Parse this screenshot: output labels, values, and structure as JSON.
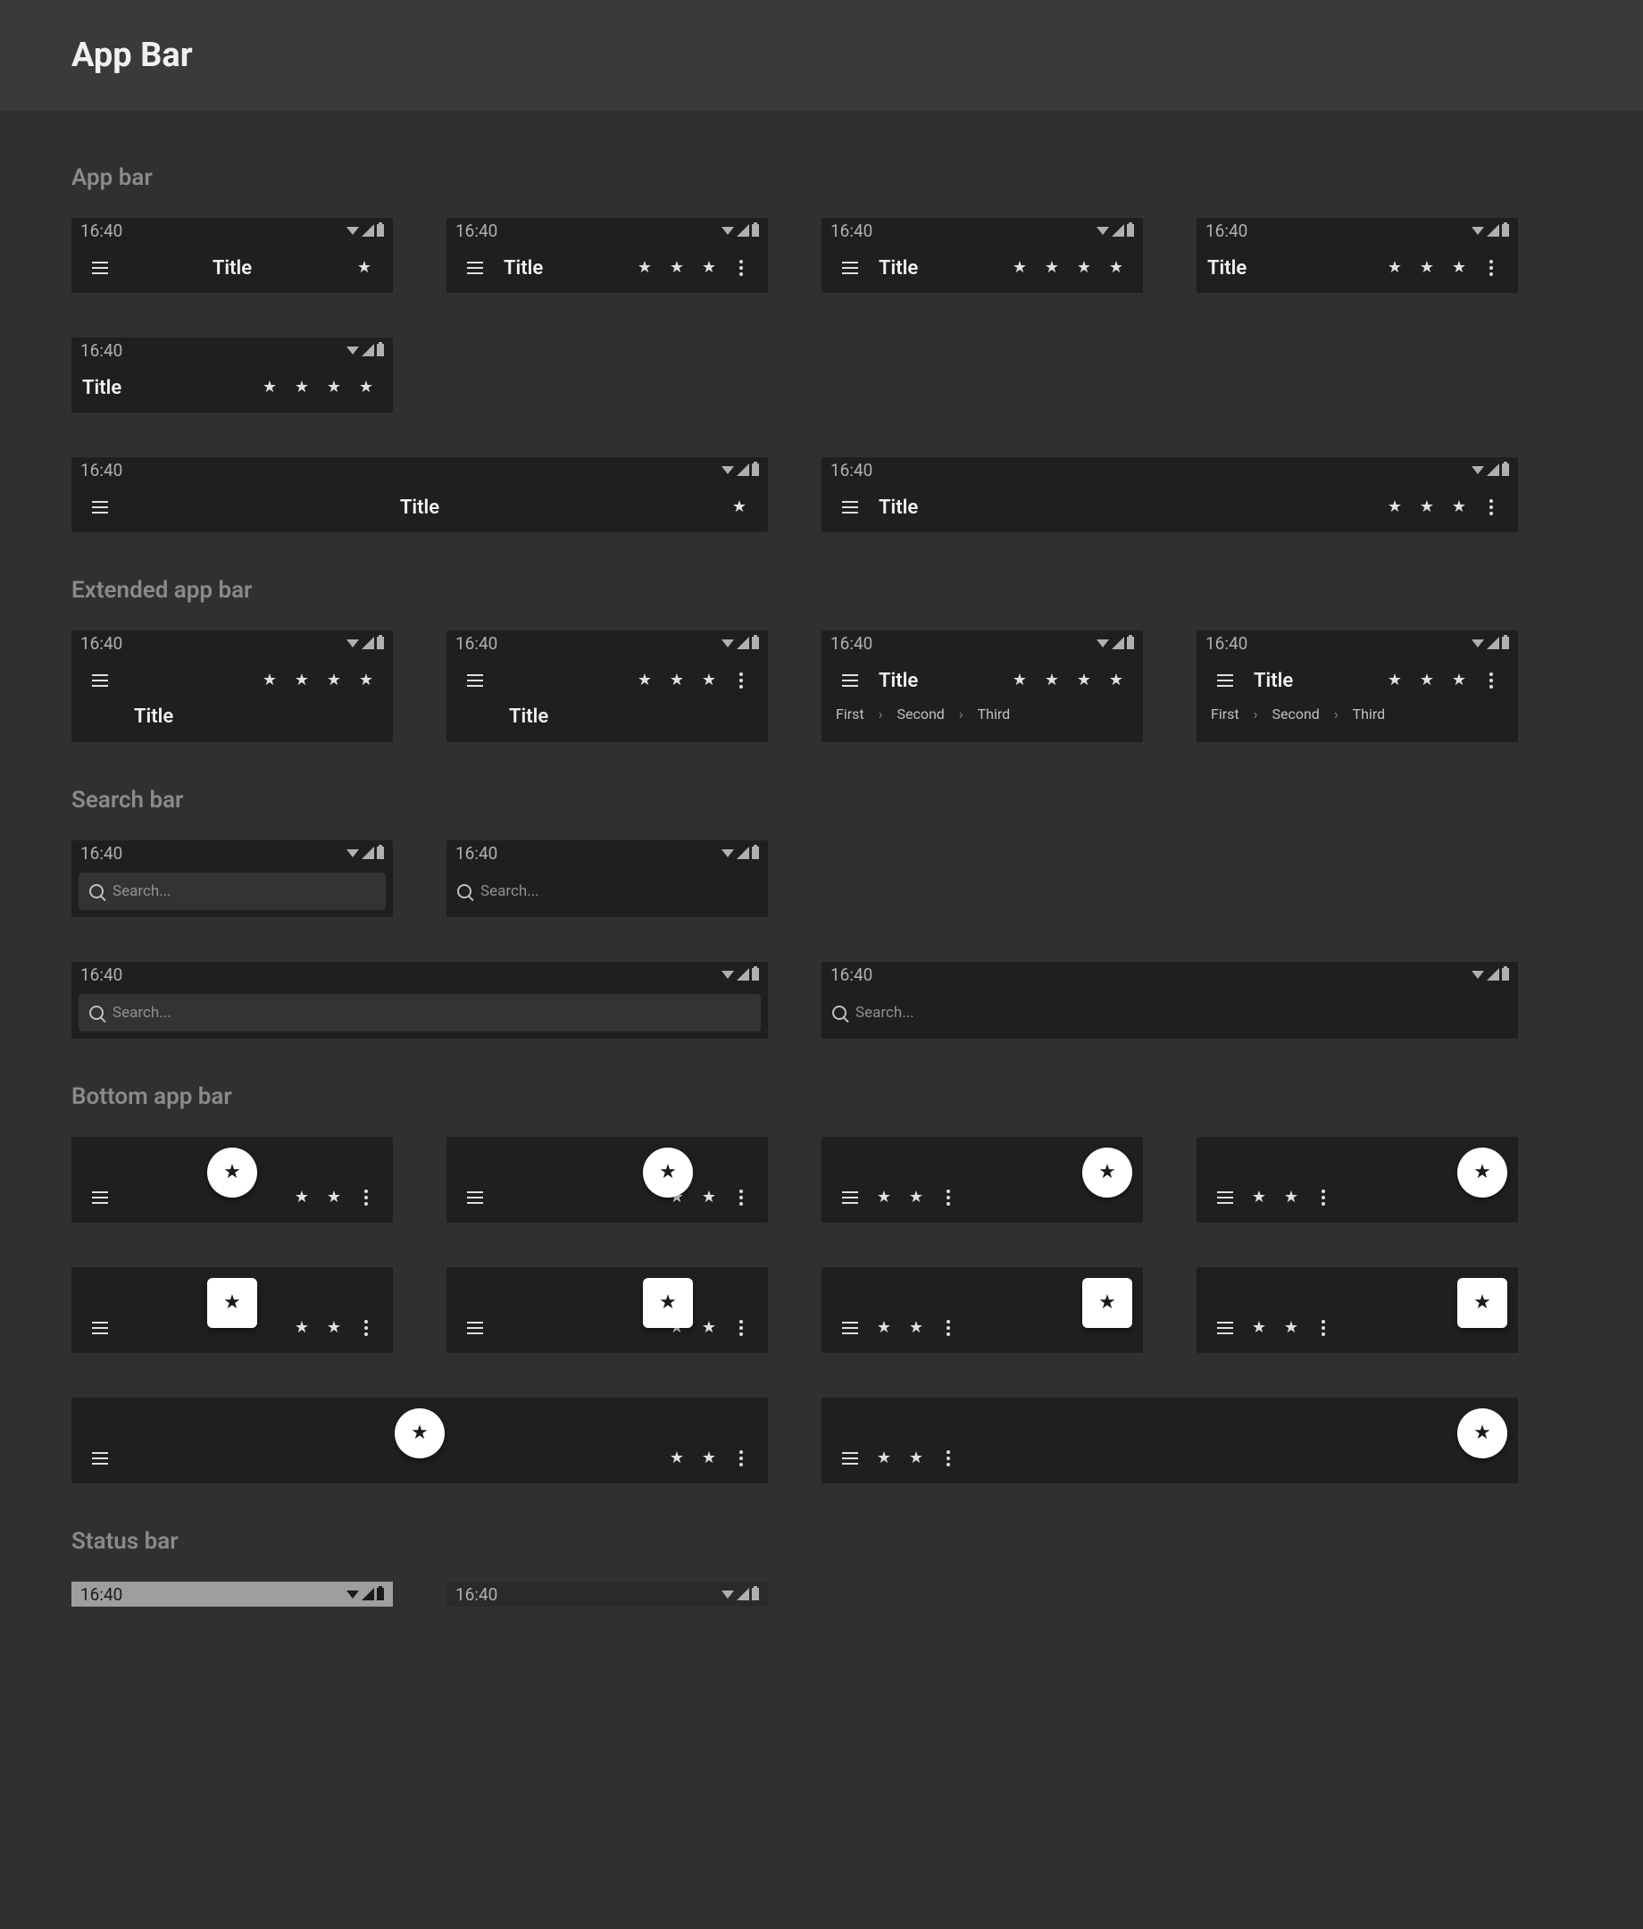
{
  "page_title": "App Bar",
  "sections": {
    "appbar": "App bar",
    "extended": "Extended app bar",
    "search": "Search bar",
    "bottom": "Bottom app bar",
    "status": "Status bar"
  },
  "status_time": "16:40",
  "title": "Title",
  "tabs": {
    "first": "First",
    "second": "Second",
    "third": "Third"
  },
  "search_placeholder": "Search..."
}
